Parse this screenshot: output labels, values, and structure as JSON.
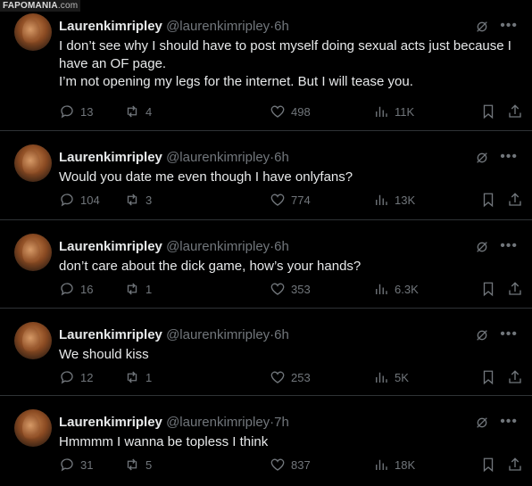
{
  "watermark": {
    "brand": "FAPOMANIA",
    "suffix": ".com"
  },
  "tweets": [
    {
      "name": "Laurenkimripley",
      "handle": "@laurenkimripley",
      "dot": "·",
      "time": "6h",
      "text": "I don’t see why I should have to post myself doing sexual acts just because I have an OF page.\nI’m not opening my legs for the internet. But I will tease you.",
      "replies": "13",
      "retweets": "4",
      "likes": "498",
      "views": "11K"
    },
    {
      "name": "Laurenkimripley",
      "handle": "@laurenkimripley",
      "dot": "·",
      "time": "6h",
      "text": "Would you date me even though I have onlyfans?",
      "replies": "104",
      "retweets": "3",
      "likes": "774",
      "views": "13K"
    },
    {
      "name": "Laurenkimripley",
      "handle": "@laurenkimripley",
      "dot": "·",
      "time": "6h",
      "text": "don’t care about the dick game, how’s your hands?",
      "replies": "16",
      "retweets": "1",
      "likes": "353",
      "views": "6.3K"
    },
    {
      "name": "Laurenkimripley",
      "handle": "@laurenkimripley",
      "dot": "·",
      "time": "6h",
      "text": "We should kiss",
      "replies": "12",
      "retweets": "1",
      "likes": "253",
      "views": "5K"
    },
    {
      "name": "Laurenkimripley",
      "handle": "@laurenkimripley",
      "dot": "·",
      "time": "7h",
      "text": "Hmmmm I wanna be topless I think",
      "replies": "31",
      "retweets": "5",
      "likes": "837",
      "views": "18K"
    }
  ],
  "colors": {
    "background": "#000000",
    "text": "#e7e9ea",
    "muted": "#71767b",
    "divider": "#2f3336"
  },
  "icons": {
    "reply": "reply-icon",
    "retweet": "retweet-icon",
    "like": "heart-icon",
    "views": "views-icon",
    "bookmark": "bookmark-icon",
    "share": "share-icon",
    "grok": "grok-icon",
    "more": "more-icon"
  }
}
